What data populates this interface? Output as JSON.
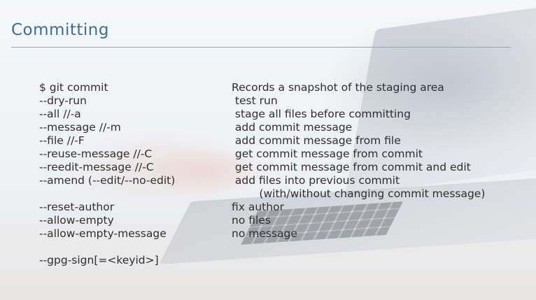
{
  "slide": {
    "title": "Committing",
    "options": [
      {
        "option": "$ git commit",
        "desc": "Records a snapshot of the staging area"
      },
      {
        "option": "--dry-run",
        "desc": " test run"
      },
      {
        "option": "--all //-a",
        "desc": " stage all files before committing"
      },
      {
        "option": "--message //-m",
        "desc": " add commit message"
      },
      {
        "option": "--file //-F",
        "desc": " add commit message from file"
      },
      {
        "option": "--reuse-message //-C",
        "desc": " get commit message from commit"
      },
      {
        "option": "--reedit-message //-C",
        "desc": " get commit message from commit and edit"
      },
      {
        "option": "--amend (--edit/--no-edit)",
        "desc": " add files into previous commit"
      },
      {
        "option": "",
        "desc": "        (with/without changing commit message)"
      },
      {
        "option": "--reset-author",
        "desc": "fix author"
      },
      {
        "option": "--allow-empty",
        "desc": "no files"
      },
      {
        "option": "--allow-empty-message",
        "desc": "no message"
      },
      {
        "option": "",
        "desc": ""
      },
      {
        "option": "--gpg-sign[=<keyid>]",
        "desc": ""
      }
    ]
  },
  "colors": {
    "title": "#3d6f96",
    "rule": "#8ba9c0",
    "text": "#2e2e2e"
  }
}
